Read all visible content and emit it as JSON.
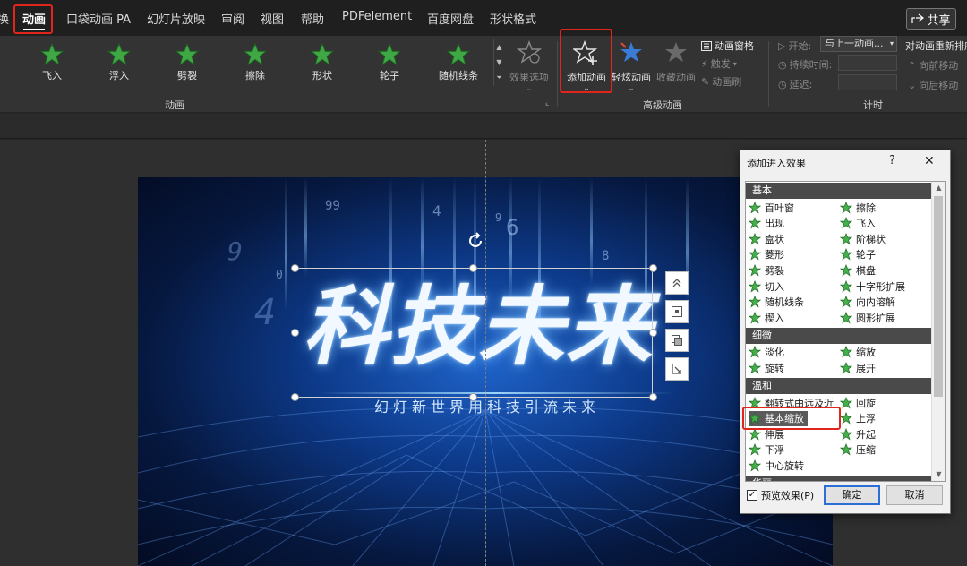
{
  "tabs": [
    {
      "label": "换",
      "active": false
    },
    {
      "label": "动画",
      "active": true
    },
    {
      "label": "口袋动画 PA",
      "active": false
    },
    {
      "label": "幻灯片放映",
      "active": false
    },
    {
      "label": "审阅",
      "active": false
    },
    {
      "label": "视图",
      "active": false
    },
    {
      "label": "帮助",
      "active": false
    },
    {
      "label": "PDFelement",
      "active": false
    },
    {
      "label": "百度网盘",
      "active": false
    },
    {
      "label": "形状格式",
      "active": false
    }
  ],
  "share_label": "共享",
  "ribbon": {
    "animation_gallery": [
      "飞入",
      "浮入",
      "劈裂",
      "擦除",
      "形状",
      "轮子",
      "随机线条"
    ],
    "effect_options_label": "效果选项",
    "group_animation_label": "动画",
    "add_animation_label": "添加动画",
    "fancy_animation_label": "轻炫动画",
    "favorite_animation_label": "收藏动画",
    "animation_pane_label": "动画窗格",
    "trigger_label": "触发",
    "animation_painter_label": "动画刷",
    "group_advanced_label": "高级动画",
    "start_label": "开始:",
    "start_value": "与上一动画...",
    "duration_label": "持续时间:",
    "delay_label": "延迟:",
    "group_timing_label": "计时",
    "reorder_label": "对动画重新排序",
    "move_earlier_label": "向前移动",
    "move_later_label": "向后移动"
  },
  "slide": {
    "title": "科技未来",
    "subtitle": "幻灯新世界用科技引流未来",
    "digits": [
      "99",
      "4",
      "6",
      "9",
      "8",
      "4",
      "0",
      "9"
    ]
  },
  "dialog": {
    "title": "添加进入效果",
    "help": "?",
    "categories": [
      {
        "name": "基本",
        "effects": [
          "百叶窗",
          "擦除",
          "出现",
          "飞入",
          "盒状",
          "阶梯状",
          "菱形",
          "轮子",
          "劈裂",
          "棋盘",
          "切入",
          "十字形扩展",
          "随机线条",
          "向内溶解",
          "楔入",
          "圆形扩展"
        ]
      },
      {
        "name": "细微",
        "effects": [
          "淡化",
          "缩放",
          "旋转",
          "展开"
        ]
      },
      {
        "name": "温和",
        "effects": [
          "翻转式由远及近",
          "回旋",
          "基本缩放",
          "上浮",
          "伸展",
          "升起",
          "下浮",
          "压缩",
          "中心旋转"
        ]
      },
      {
        "name": "华丽",
        "effects": []
      }
    ],
    "selected_effect": "基本缩放",
    "preview_label": "预览效果(P)",
    "preview_checked": true,
    "ok_label": "确定",
    "cancel_label": "取消"
  }
}
